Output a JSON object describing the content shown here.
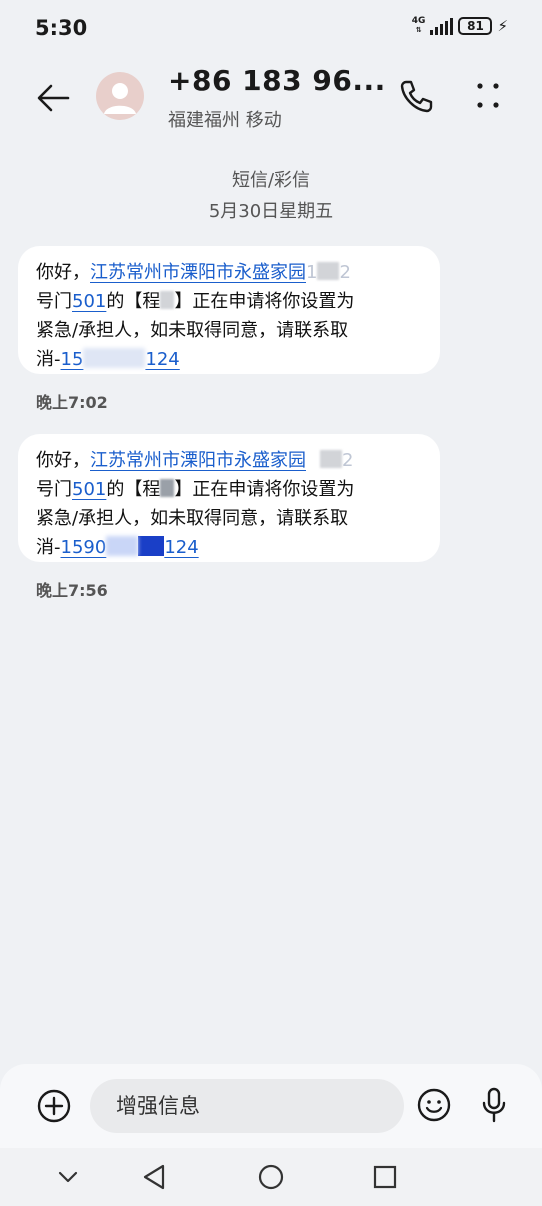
{
  "status_bar": {
    "time": "5:30",
    "network": "4G",
    "battery": "81"
  },
  "header": {
    "contact_name": "+86 183 96...",
    "contact_location": "福建福州 移动"
  },
  "thread": {
    "channel_label": "短信/彩信",
    "date_label": "5月30日星期五",
    "messages": [
      {
        "greeting": "你好，",
        "address_link": "江苏常州市溧阳市永盛家园",
        "address_tail": "1",
        "address_tail2": "2",
        "line2_prefix": "号门",
        "room_link": "501",
        "line2_mid": "的【",
        "name_char": "程",
        "line2_suffix": "】正在申请将你设置为",
        "line3": "紧急/承担人，如未取得同意，请联系取",
        "line4_prefix": "消-",
        "phone_start": "15",
        "phone_end": "124",
        "time": "晚上7:02"
      },
      {
        "greeting": "你好，",
        "address_link": "江苏常州市溧阳市永盛家园",
        "address_tail": "",
        "address_tail2": "2",
        "line2_prefix": "号门",
        "room_link": "501",
        "line2_mid": "的【",
        "name_char": "程",
        "line2_suffix": "】正在申请将你设置为",
        "line3": "紧急/承担人，如未取得同意，请联系取",
        "line4_prefix": "消-",
        "phone_start": "1590",
        "phone_end": "124",
        "time": "晚上7:56"
      }
    ]
  },
  "composer": {
    "placeholder": "增强信息"
  },
  "icons": {
    "back": "back-arrow-icon",
    "avatar": "person-avatar-icon",
    "call": "phone-icon",
    "more": "more-vertical-icon",
    "add": "plus-circle-icon",
    "emoji": "emoji-icon",
    "mic": "microphone-icon",
    "nav_hide": "chevron-down-icon",
    "nav_back": "triangle-back-icon",
    "nav_home": "circle-home-icon",
    "nav_recent": "square-recent-icon"
  },
  "colors": {
    "link": "#1a5ecc",
    "bubble": "#ffffff",
    "background": "#eff1f4"
  }
}
